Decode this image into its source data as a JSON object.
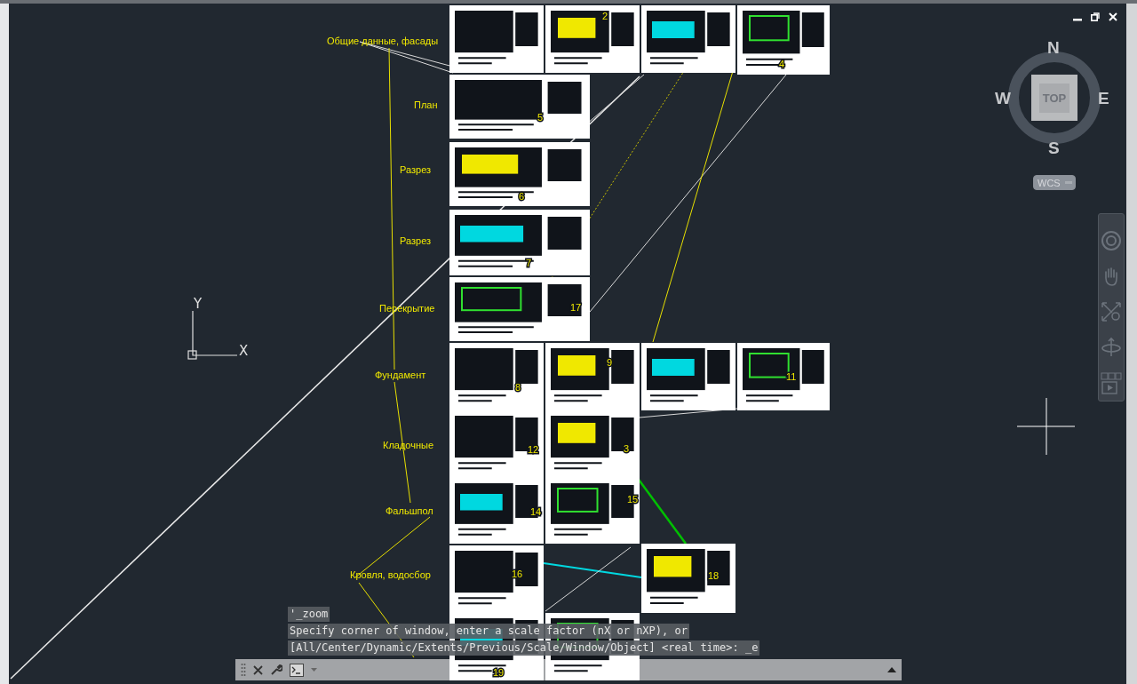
{
  "drawing": {
    "labels": [
      "Общие данные, фасады",
      "План",
      "Разрез",
      "Разрез",
      "Перекрытие",
      "Фундамент",
      "Кладочные",
      "Фальшпол",
      "Кровля, водосбор"
    ],
    "sheets": [
      {
        "kind": "plain"
      },
      {
        "kind": "numbered",
        "label": "2"
      },
      {
        "kind": "plain"
      },
      {
        "kind": "numbered",
        "label": "4"
      },
      {
        "kind": "numbered",
        "label": "5"
      },
      {
        "kind": "numbered",
        "label": "6"
      },
      {
        "kind": "numbered",
        "label": "7"
      },
      {
        "kind": "numbered",
        "label": "17"
      },
      {
        "kind": "numbered",
        "label": "8"
      },
      {
        "kind": "numbered",
        "label": "9"
      },
      {
        "kind": "plain"
      },
      {
        "kind": "numbered",
        "label": "11"
      },
      {
        "kind": "numbered",
        "label": "12"
      },
      {
        "kind": "numbered",
        "label": "3"
      },
      {
        "kind": "numbered",
        "label": "14"
      },
      {
        "kind": "numbered",
        "label": "15"
      },
      {
        "kind": "numbered",
        "label": "16"
      },
      {
        "kind": "numbered",
        "label": "18"
      },
      {
        "kind": "numbered",
        "label": "19"
      },
      {
        "kind": "plain"
      }
    ],
    "ucs": {
      "y_label": "Y",
      "x_label": "X"
    }
  },
  "viewcube": {
    "north": "N",
    "south": "S",
    "east": "E",
    "west": "W",
    "face": "TOP",
    "coordinate_system": "WCS"
  },
  "command_line": {
    "history": [
      "'_zoom",
      "Specify corner of window, enter a scale factor (nX or nXP), or",
      "[All/Center/Dynamic/Extents/Previous/Scale/Window/Object] <real time>: _e"
    ]
  }
}
